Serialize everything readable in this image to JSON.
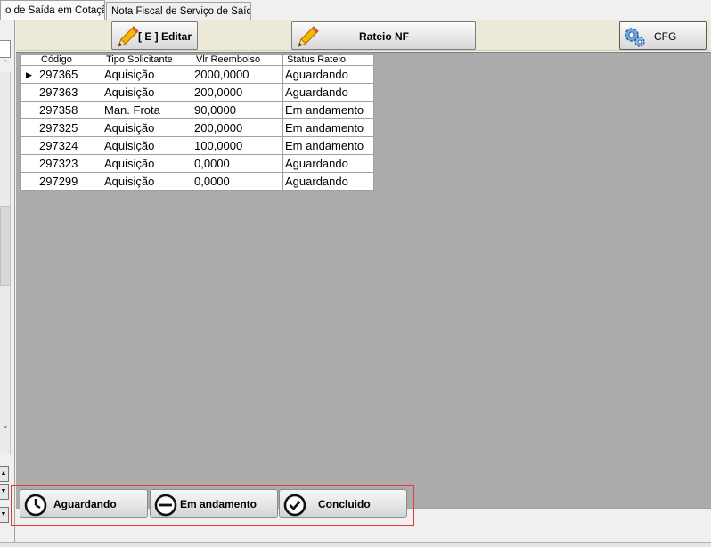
{
  "tabs": [
    {
      "label": "o de Saída em Cotação.",
      "active": true
    },
    {
      "label": "Nota Fiscal de Serviço de Saída",
      "active": false
    }
  ],
  "toolbar": {
    "edit_label": "[ E ] Editar",
    "rateio_label": "Rateio NF",
    "cfg_label": "CFG"
  },
  "grid": {
    "columns": [
      "Código",
      "Tipo Solicitante",
      "Vlr Reembolso",
      "Status Rateio"
    ],
    "rows": [
      [
        "297365",
        "Aquisição",
        "2000,0000",
        "Aguardando"
      ],
      [
        "297363",
        "Aquisição",
        "200,0000",
        "Aguardando"
      ],
      [
        "297358",
        "Man. Frota",
        "90,0000",
        "Em andamento"
      ],
      [
        "297325",
        "Aquisição",
        "200,0000",
        "Em andamento"
      ],
      [
        "297324",
        "Aquisição",
        "100,0000",
        "Em andamento"
      ],
      [
        "297323",
        "Aquisição",
        "0,0000",
        "Aguardando"
      ],
      [
        "297299",
        "Aquisição",
        "0,0000",
        "Aguardando"
      ]
    ],
    "current_row_marker": "▶"
  },
  "legend": {
    "aguardando_label": "Aguardando",
    "em_andamento_label": "Em andamento",
    "concluido_label": "Concluido"
  },
  "colors": {
    "toolbar_bg": "#ece9d8",
    "grid_bg": "#ababab",
    "highlight_border": "#e23a3a"
  },
  "icons": {
    "edit": "pencil-icon",
    "rateio": "pencil-icon",
    "cfg": "gears-icon",
    "aguardando": "clock-icon",
    "em_andamento": "minus-circle-icon",
    "concluido": "check-circle-icon"
  }
}
